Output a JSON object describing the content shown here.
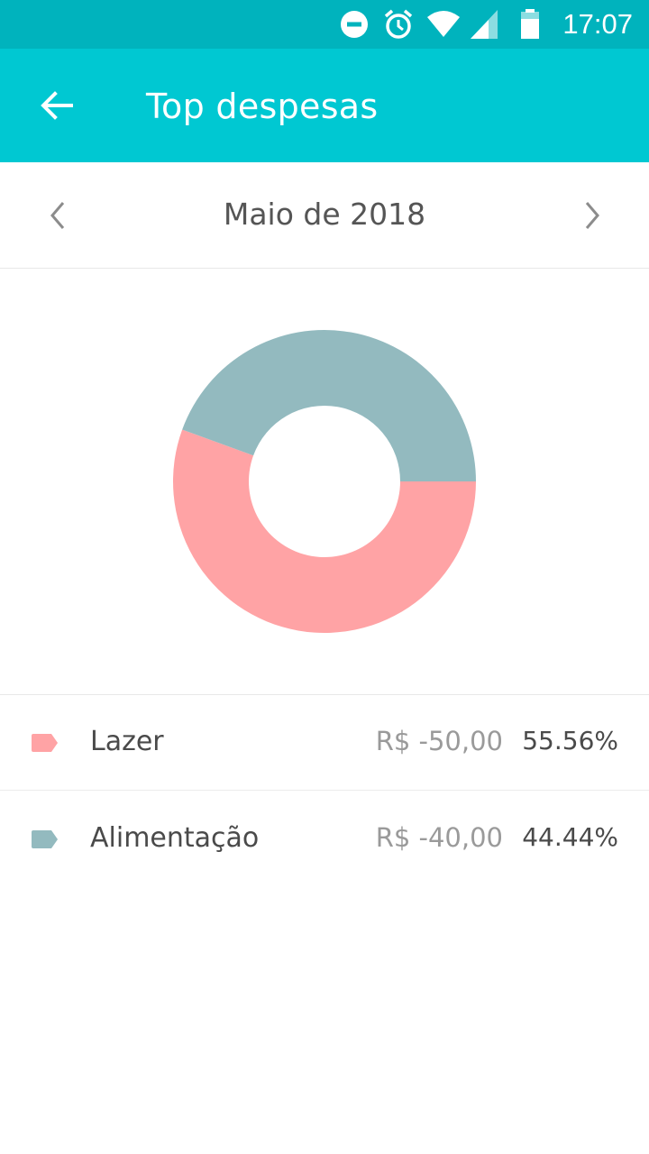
{
  "status_bar": {
    "time": "17:07",
    "icons": [
      "do-not-disturb-icon",
      "alarm-icon",
      "wifi-icon",
      "signal-icon",
      "battery-icon"
    ]
  },
  "app_bar": {
    "title": "Top despesas",
    "back_icon": "arrow-left-icon",
    "color": "#00c8d2"
  },
  "month_nav": {
    "label": "Maio de 2018",
    "prev_icon": "chevron-left-icon",
    "next_icon": "chevron-right-icon"
  },
  "chart_data": {
    "type": "pie",
    "categories": [
      "Lazer",
      "Alimentação"
    ],
    "values": [
      55.56,
      44.44
    ],
    "colors": [
      "#ffa3a5",
      "#93babf"
    ],
    "donut": true
  },
  "legend": [
    {
      "name": "Lazer",
      "amount": "R$ -50,00",
      "percent": "55.56%",
      "color": "#ffa3a5"
    },
    {
      "name": "Alimentação",
      "amount": "R$ -40,00",
      "percent": "44.44%",
      "color": "#93babf"
    }
  ]
}
